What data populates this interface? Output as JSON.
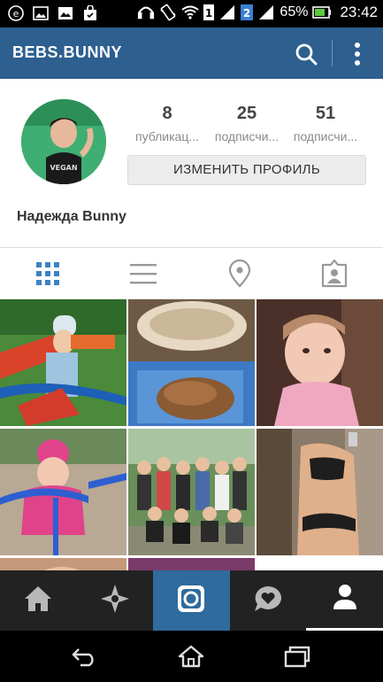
{
  "status_bar": {
    "battery_percent": "65%",
    "time": "23:42",
    "sim_label": "1",
    "sim2_label": "2"
  },
  "header": {
    "username": "BEBS.BUNNY"
  },
  "profile": {
    "full_name": "Надежда Bunny",
    "edit_button_label": "ИЗМЕНИТЬ ПРОФИЛЬ",
    "stats": [
      {
        "value": "8",
        "label": "публикац..."
      },
      {
        "value": "25",
        "label": "подписчи..."
      },
      {
        "value": "51",
        "label": "подписчи..."
      }
    ]
  },
  "view_tabs": [
    "grid-view",
    "list-view",
    "location-view",
    "tagged-view"
  ],
  "photos": [
    "child-on-playground",
    "food-bowl-and-pastry",
    "child-indoors",
    "child-pink-jacket-swing",
    "group-photo-outdoors",
    "mirror-selfie",
    "partial-photo-1",
    "partial-photo-2"
  ],
  "bottom_nav": [
    "home",
    "explore",
    "camera",
    "activity",
    "profile"
  ],
  "system_nav": [
    "back",
    "home",
    "recent-apps"
  ],
  "colors": {
    "header_bg": "#2d5f8f",
    "accent_blue": "#2f6b9c",
    "grid_icon_active": "#3c82c4",
    "nav_bg": "#222222"
  }
}
